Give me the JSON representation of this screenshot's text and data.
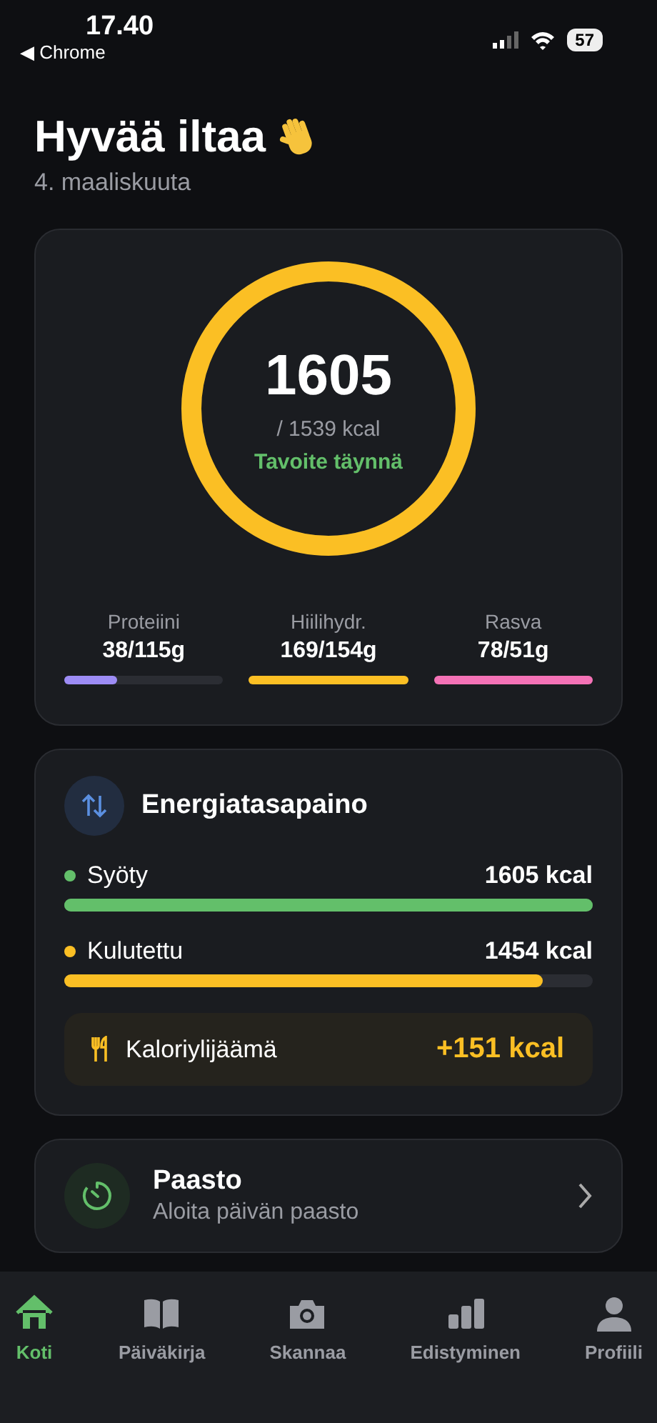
{
  "status_bar": {
    "time": "17.40",
    "back_app": "◀ Chrome",
    "battery": "57"
  },
  "header": {
    "greeting": "Hyvää iltaa",
    "date": "4. maaliskuuta"
  },
  "calorie_ring": {
    "value": "1605",
    "target": "/ 1539 kcal",
    "status": "Tavoite täynnä",
    "level": 1
  },
  "macros": [
    {
      "name": "Proteiini",
      "amount": "38/115g",
      "level": 0.33,
      "color": "#9d8cf5"
    },
    {
      "name": "Hiilihydr.",
      "amount": "169/154g",
      "level": 1,
      "color": "#fbbf24"
    },
    {
      "name": "Rasva",
      "amount": "78/51g",
      "level": 1,
      "color": "#f472b6"
    }
  ],
  "energy": {
    "title": "Energiatasapaino",
    "rows": [
      {
        "label": "Syöty",
        "value": "1605 kcal",
        "level": 1,
        "color": "#63bf6a"
      },
      {
        "label": "Kulutettu",
        "value": "1454 kcal",
        "level": 0.906,
        "color": "#fbbf24"
      }
    ],
    "surplus": {
      "label": "Kaloriylijäämä",
      "value": "+151 kcal"
    }
  },
  "fasting": {
    "title": "Paasto",
    "subtitle": "Aloita päivän paasto"
  },
  "tabs": [
    {
      "label": "Koti",
      "kind": "home",
      "selected": true
    },
    {
      "label": "Päiväkirja",
      "kind": "book",
      "selected": false
    },
    {
      "label": "Skannaa",
      "kind": "camera",
      "selected": false
    },
    {
      "label": "Edistyminen",
      "kind": "chart",
      "selected": false
    },
    {
      "label": "Profiili",
      "kind": "person",
      "selected": false
    }
  ]
}
